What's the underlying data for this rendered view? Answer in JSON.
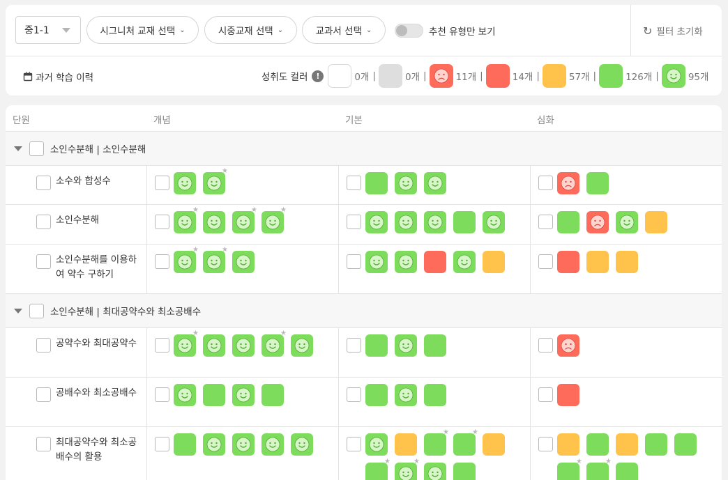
{
  "filters": {
    "grade": "중1-1",
    "signature": "시그니처 교재 선택",
    "market": "시중교재 선택",
    "textbook": "교과서 선택",
    "toggle_label": "추천 유형만 보기",
    "reset": "필터 초기화"
  },
  "history_label": "과거 학습 이력",
  "legend": {
    "title": "성취도 컬러",
    "items": [
      {
        "kind": "white",
        "count": "0개"
      },
      {
        "kind": "gray",
        "count": "0개"
      },
      {
        "kind": "red-sad",
        "count": "11개"
      },
      {
        "kind": "red",
        "count": "14개"
      },
      {
        "kind": "yellow",
        "count": "57개"
      },
      {
        "kind": "green",
        "count": "126개"
      },
      {
        "kind": "green-smile",
        "count": "95개"
      }
    ]
  },
  "colors": {
    "green": "#7edc5c",
    "red": "#ff6b5b",
    "yellow": "#ffc24a",
    "gray": "#dedede"
  },
  "table": {
    "headers": [
      "단원",
      "개념",
      "기본",
      "심화"
    ],
    "sections": [
      {
        "title": "소인수분해 | 소인수분해",
        "rows": [
          {
            "name": "소수와 합성수",
            "concept": [
              {
                "c": "g",
                "f": "smile"
              },
              {
                "c": "g",
                "f": "smile",
                "star": true
              }
            ],
            "basic": [
              {
                "c": "g"
              },
              {
                "c": "g",
                "f": "smile"
              },
              {
                "c": "g",
                "f": "smile"
              }
            ],
            "advanced": [
              {
                "c": "r",
                "f": "sad"
              },
              {
                "c": "g"
              }
            ]
          },
          {
            "name": "소인수분해",
            "concept": [
              {
                "c": "g",
                "f": "smile",
                "star": true
              },
              {
                "c": "g",
                "f": "smile"
              },
              {
                "c": "g",
                "f": "smile",
                "star": true
              },
              {
                "c": "g",
                "f": "smile",
                "star": true
              }
            ],
            "basic": [
              {
                "c": "g",
                "f": "smile"
              },
              {
                "c": "g",
                "f": "smile"
              },
              {
                "c": "g",
                "f": "smile"
              },
              {
                "c": "g"
              },
              {
                "c": "g",
                "f": "smile"
              }
            ],
            "advanced": [
              {
                "c": "g"
              },
              {
                "c": "r",
                "f": "sad"
              },
              {
                "c": "g",
                "f": "smile"
              },
              {
                "c": "y"
              }
            ]
          },
          {
            "name": "소인수분해를 이용하여 약수 구하기",
            "concept": [
              {
                "c": "g",
                "f": "smile",
                "star": true
              },
              {
                "c": "g",
                "f": "smile",
                "star": true
              },
              {
                "c": "g",
                "f": "smile"
              }
            ],
            "basic": [
              {
                "c": "g",
                "f": "smile"
              },
              {
                "c": "g",
                "f": "smile"
              },
              {
                "c": "r"
              },
              {
                "c": "g",
                "f": "smile"
              },
              {
                "c": "y"
              }
            ],
            "advanced": [
              {
                "c": "r"
              },
              {
                "c": "y"
              },
              {
                "c": "y"
              }
            ]
          }
        ]
      },
      {
        "title": "소인수분해 | 최대공약수와 최소공배수",
        "rows": [
          {
            "name": "공약수와 최대공약수",
            "concept": [
              {
                "c": "g",
                "f": "smile",
                "star": true
              },
              {
                "c": "g",
                "f": "smile"
              },
              {
                "c": "g",
                "f": "smile"
              },
              {
                "c": "g",
                "f": "smile",
                "star": true
              },
              {
                "c": "g",
                "f": "smile"
              }
            ],
            "basic": [
              {
                "c": "g"
              },
              {
                "c": "g",
                "f": "smile"
              },
              {
                "c": "g"
              }
            ],
            "advanced": [
              {
                "c": "r",
                "f": "sad"
              }
            ]
          },
          {
            "name": "공배수와 최소공배수",
            "concept": [
              {
                "c": "g",
                "f": "smile"
              },
              {
                "c": "g"
              },
              {
                "c": "g",
                "f": "smile"
              },
              {
                "c": "g"
              }
            ],
            "basic": [
              {
                "c": "g"
              },
              {
                "c": "g",
                "f": "smile"
              },
              {
                "c": "g"
              }
            ],
            "advanced": [
              {
                "c": "r"
              }
            ]
          },
          {
            "name": "최대공약수와 최소공배수의 활용",
            "concept": [
              {
                "c": "g"
              },
              {
                "c": "g",
                "f": "smile"
              },
              {
                "c": "g",
                "f": "smile"
              },
              {
                "c": "g",
                "f": "smile"
              },
              {
                "c": "g",
                "f": "smile"
              }
            ],
            "basic": [
              {
                "c": "g",
                "f": "smile"
              },
              {
                "c": "y"
              },
              {
                "c": "g",
                "star": true
              },
              {
                "c": "g",
                "star": true
              },
              {
                "c": "y"
              },
              {
                "c": "g",
                "star": true
              },
              {
                "c": "g",
                "f": "smile",
                "star": true
              },
              {
                "c": "g",
                "f": "smile"
              },
              {
                "c": "g"
              }
            ],
            "advanced": [
              {
                "c": "y"
              },
              {
                "c": "g"
              },
              {
                "c": "y"
              },
              {
                "c": "g"
              },
              {
                "c": "g"
              },
              {
                "c": "g",
                "star": true
              },
              {
                "c": "g",
                "star": true
              },
              {
                "c": "g"
              }
            ]
          }
        ]
      }
    ]
  }
}
